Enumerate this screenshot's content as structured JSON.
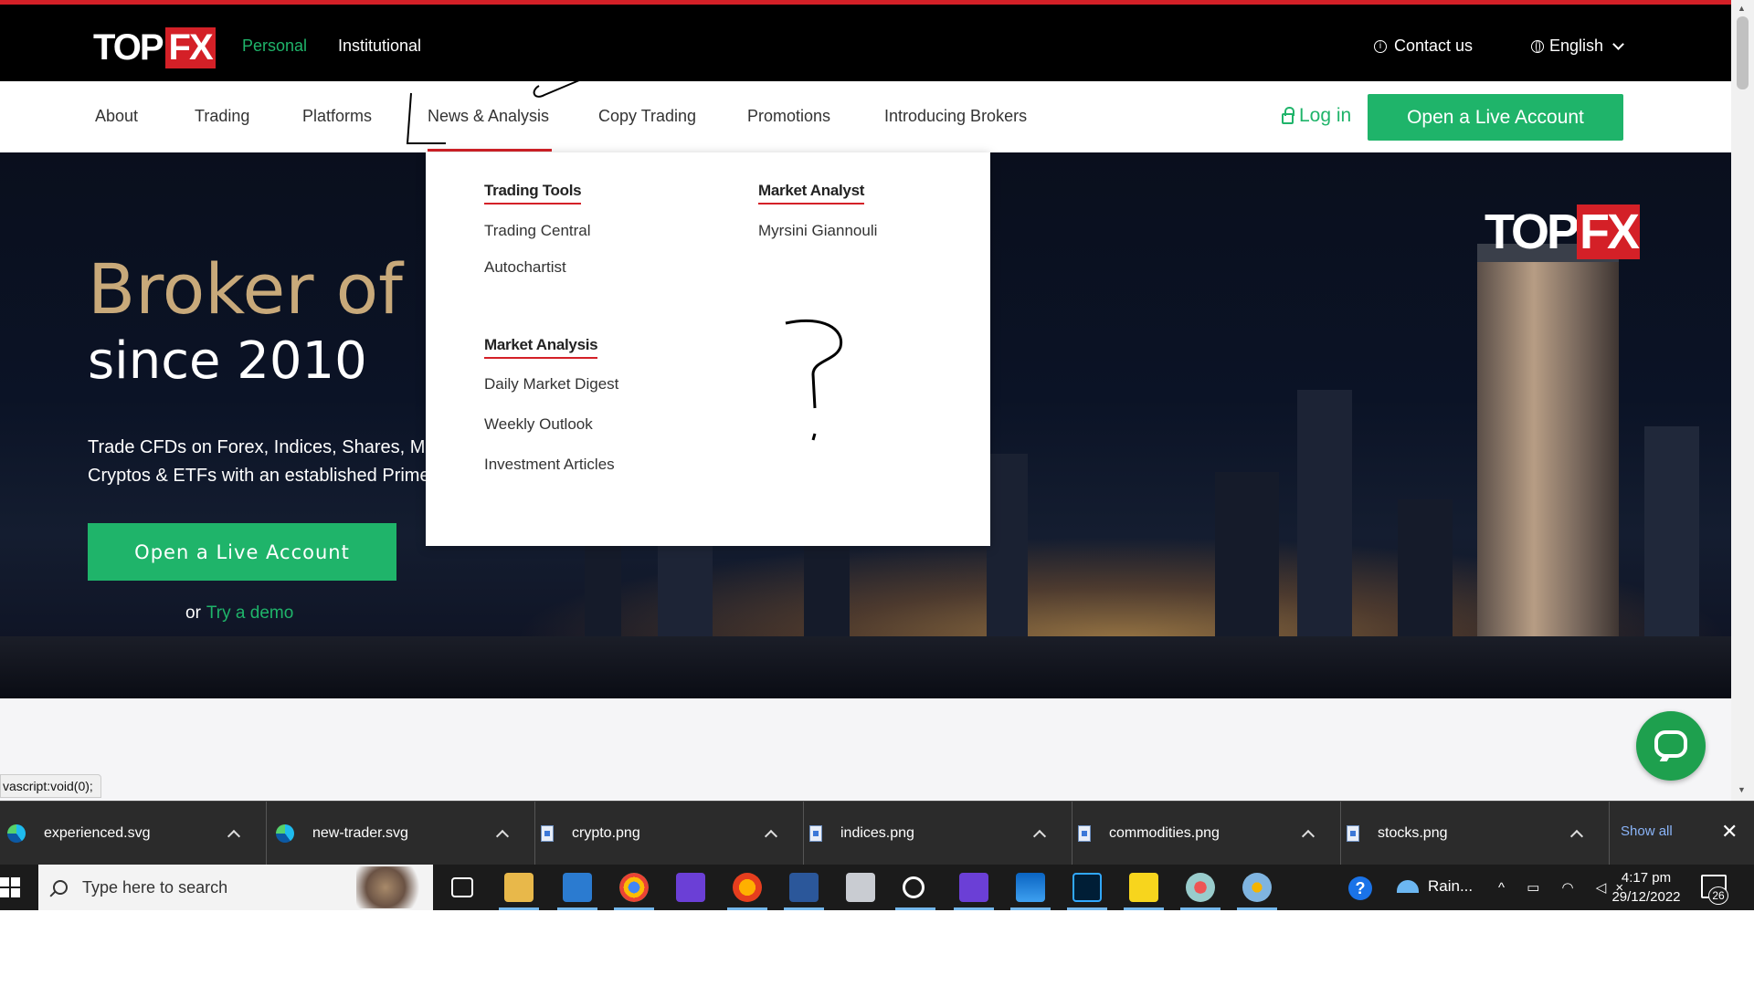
{
  "topbar": {
    "logo_top": "TOP",
    "logo_fx": "FX",
    "nav_personal": "Personal",
    "nav_institutional": "Institutional",
    "contact": "Contact us",
    "language": "English",
    "accent_red": "#d42027",
    "accent_green": "#1fb46a"
  },
  "mainnav": {
    "items": [
      "About",
      "Trading",
      "Platforms",
      "News & Analysis",
      "Copy Trading",
      "Promotions",
      "Introducing Brokers"
    ],
    "active": "News & Analysis",
    "login": "Log in",
    "open_live": "Open a Live Account"
  },
  "dropdown": {
    "trading_tools": {
      "heading": "Trading Tools",
      "items": [
        "Trading Central",
        "Autochartist"
      ]
    },
    "market_analyst": {
      "heading": "Market Analyst",
      "items": [
        "Myrsini Giannouli"
      ]
    },
    "market_analysis": {
      "heading": "Market Analysis",
      "items": [
        "Daily Market Digest",
        "Weekly Outlook",
        "Investment Articles"
      ]
    }
  },
  "hero": {
    "title_line1": "Broker of I",
    "title_line2": "since 2010",
    "subtitle_line1": "Trade CFDs on Forex, Indices, Shares, Meta",
    "subtitle_line2": "Cryptos & ETFs with an established Prime",
    "cta": "Open a Live Account",
    "or": "or",
    "try_demo": "Try a demo",
    "tower_logo_top": "TOP",
    "tower_logo_fx": "FX"
  },
  "status_url": "vascript:void(0);",
  "downloads": {
    "items": [
      {
        "name": "experienced.svg",
        "icon": "edge-icon"
      },
      {
        "name": "new-trader.svg",
        "icon": "edge-icon"
      },
      {
        "name": "crypto.png",
        "icon": "file-icon"
      },
      {
        "name": "indices.png",
        "icon": "file-icon"
      },
      {
        "name": "commodities.png",
        "icon": "file-icon"
      },
      {
        "name": "stocks.png",
        "icon": "file-icon"
      }
    ],
    "show_all": "Show all",
    "close": "✕"
  },
  "taskbar": {
    "search_placeholder": "Type here to search",
    "weather": "Rain...",
    "time": "4:17 pm",
    "date": "29/12/2022",
    "notifications": "26",
    "tray_glyphs": "^ ▭ ◠ ◁×"
  }
}
